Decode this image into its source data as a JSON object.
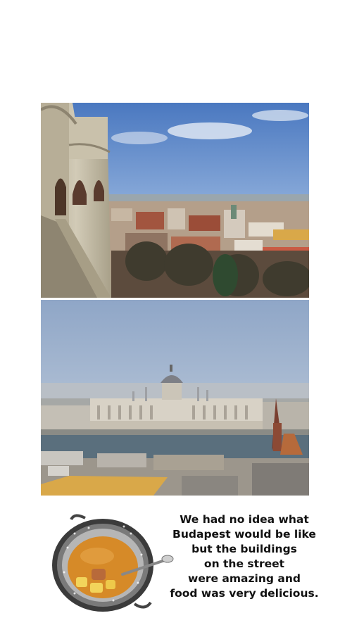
{
  "caption": {
    "lines": [
      "We had no idea what",
      "Budapest would be like",
      "but the buildings",
      "on the street",
      "were amazing and",
      "food was very delicious."
    ]
  },
  "colors": {
    "sky_top": "#4a78c0",
    "sky_haze": "#c9d4e2",
    "river": "#5a6f7d",
    "parliament_stone": "#d8d2c6",
    "roof_red": "#a2553f",
    "soup": "#d68a28"
  }
}
